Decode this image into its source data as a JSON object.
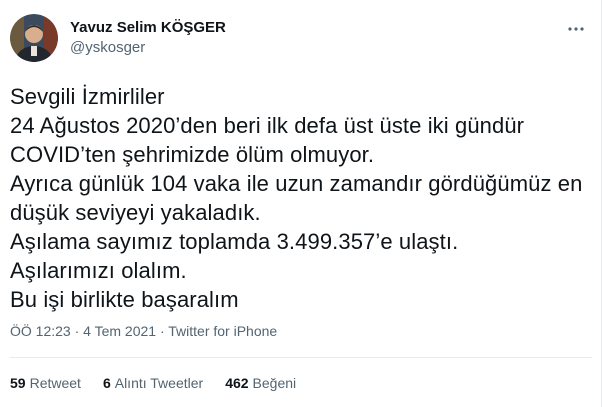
{
  "user": {
    "display_name": "Yavuz Selim KÖŞGER",
    "handle": "@yskosger",
    "avatar_icon": "profile-photo"
  },
  "more_icon": "more-options-icon",
  "tweet": {
    "text": "Sevgili İzmirliler\n24 Ağustos 2020’den beri ilk defa üst üste iki gündür COVID’ten şehrimizde ölüm olmuyor.\nAyrıca günlük 104 vaka ile uzun zamandır gördüğümüz en düşük seviyeyi yakaladık.\nAşılama sayımız toplamda 3.499.357’e ulaştı.\nAşılarımızı olalım.\nBu işi birlikte başaralım"
  },
  "meta": {
    "time": "ÖÖ 12:23",
    "separator1": "·",
    "date": "4 Tem 2021",
    "separator2": "·",
    "source": "Twitter for iPhone"
  },
  "stats": {
    "retweets_count": "59",
    "retweets_label": "Retweet",
    "quotes_count": "6",
    "quotes_label": "Alıntı Tweetler",
    "likes_count": "462",
    "likes_label": "Beğeni"
  },
  "colors": {
    "text_primary": "#0f1419",
    "text_secondary": "#536471",
    "divider": "#e6ecf0"
  }
}
